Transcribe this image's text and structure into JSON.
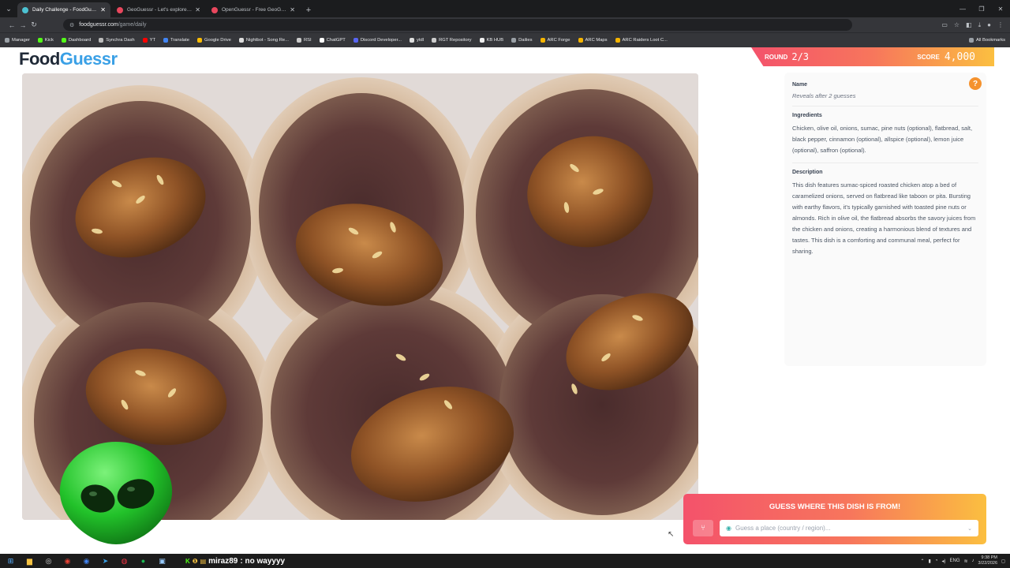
{
  "browser": {
    "tabs": [
      {
        "title": "Daily Challenge - FoodGuessr",
        "favicon_color": "#4cc2d2",
        "active": true
      },
      {
        "title": "GeoGuessr - Let's explore the w",
        "favicon_color": "#e8475d",
        "active": false
      },
      {
        "title": "OpenGuessr - Free GeoGuessr",
        "favicon_color": "#e8475d",
        "active": false
      }
    ],
    "url_host": "foodguessr.com",
    "url_path": "/game/daily",
    "bookmarks": [
      "Manager",
      "Kick",
      "Dashboard",
      "Synchra Dash",
      "YT",
      "Translate",
      "Google Drive",
      "Nightbot - Song Re...",
      "RSI",
      "ChatGPT",
      "Discord Developer...",
      "ytdl",
      "RGT Repository",
      "KB HUB",
      "Dailies",
      "ARC Forge",
      "ARC Maps",
      "ARC Raiders Loot C..."
    ],
    "all_bookmarks": "All Bookmarks"
  },
  "game": {
    "logo_part1": "Food",
    "logo_part2": "Guessr",
    "round_label": "ROUND",
    "round_value": "2/3",
    "score_label": "SCORE",
    "score_value": "4,000"
  },
  "info": {
    "name_title": "Name",
    "name_value": "Reveals after 2 guesses",
    "ingredients_title": "Ingredients",
    "ingredients_text": "Chicken, olive oil, onions, sumac, pine nuts (optional), flatbread, salt, black pepper, cinnamon (optional), allspice (optional), lemon juice (optional), saffron (optional).",
    "description_title": "Description",
    "description_text": "This dish features sumac-spiced roasted chicken atop a bed of caramelized onions, served on flatbread like taboon or pita. Bursting with earthy flavors, it's typically garnished with toasted pine nuts or almonds. Rich in olive oil, the flatbread absorbs the savory juices from the chicken and onions, creating a harmonious blend of textures and tastes. This dish is a comforting and communal meal, perfect for sharing."
  },
  "guess": {
    "title": "GUESS WHERE THIS DISH IS FROM!",
    "placeholder": "Guess a place (country / region)..."
  },
  "taskbar": {
    "chat_user": "miraz89",
    "chat_message": ": no wayyyy",
    "language": "ENG",
    "time": "9:38 PM",
    "date": "3/22/2026"
  },
  "colors": {
    "accent_gradient_start": "#f4526b",
    "accent_gradient_end": "#fbbf40",
    "logo_blue": "#3aa0e6",
    "help_orange": "#f5922e"
  }
}
